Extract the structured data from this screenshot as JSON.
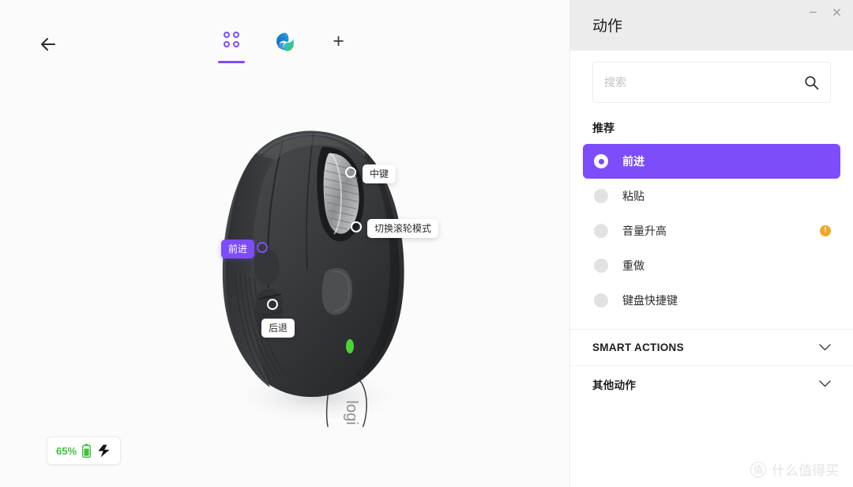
{
  "canvas": {
    "back_icon": "arrow-left-icon",
    "tabs": [
      {
        "id": "apps",
        "icon": "apps-grid-icon",
        "active": true
      },
      {
        "id": "edge",
        "icon": "microsoft-edge-icon",
        "active": false
      },
      {
        "id": "add",
        "icon": "plus-icon",
        "label": "+",
        "active": false
      }
    ],
    "device": {
      "name": "logi",
      "callouts": [
        {
          "id": "middle-click",
          "label": "中键"
        },
        {
          "id": "scroll-mode",
          "label": "切换滚轮模式"
        },
        {
          "id": "forward",
          "label": "前进",
          "highlighted": true
        },
        {
          "id": "back",
          "label": "后退"
        }
      ]
    },
    "battery": {
      "percent_label": "65%",
      "battery_icon": "battery-icon",
      "flow_icon": "logi-flow-icon",
      "accent_color": "#3ec03e"
    }
  },
  "panel": {
    "title": "动作",
    "window_controls": [
      {
        "id": "minimize",
        "glyph": "—"
      },
      {
        "id": "close",
        "glyph": "✕"
      }
    ],
    "search": {
      "placeholder": "搜索",
      "value": "",
      "icon": "search-icon"
    },
    "recommended": {
      "heading": "推荐",
      "items": [
        {
          "label": "前进",
          "selected": true,
          "warning": false
        },
        {
          "label": "粘贴",
          "selected": false,
          "warning": false
        },
        {
          "label": "音量升高",
          "selected": false,
          "warning": true,
          "warning_glyph": "!"
        },
        {
          "label": "重做",
          "selected": false,
          "warning": false
        },
        {
          "label": "键盘快捷键",
          "selected": false,
          "warning": false
        }
      ]
    },
    "sections": [
      {
        "title": "SMART ACTIONS",
        "expanded": false,
        "chevron": "chevron-down-icon"
      },
      {
        "title": "其他动作",
        "expanded": false,
        "chevron": "chevron-down-icon"
      }
    ],
    "accent_color": "#7d4dfb",
    "warning_color": "#f5a623"
  },
  "watermark": {
    "mark": "值",
    "text": "什么值得买"
  }
}
